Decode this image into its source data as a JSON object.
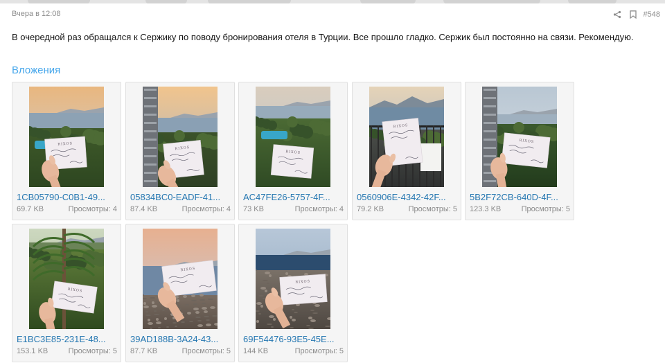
{
  "post": {
    "timestamp": "Вчера в 12:08",
    "number": "#548",
    "message": "В очередной раз обращался к Сержику по поводу бронирования отеля в Турции. Все прошло гладко. Сержик был постоянно на связи. Рекомендую.",
    "share_icon": "share-icon",
    "bookmark_icon": "bookmark-icon"
  },
  "attachments_title": "Вложения",
  "attachments": [
    {
      "name": "1CB05790-C0B1-49...",
      "size": "69.7 KB",
      "views": "Просмотры: 4",
      "scene": "coast-sunset"
    },
    {
      "name": "05834BC0-EADF-41...",
      "size": "87.4 KB",
      "views": "Просмотры: 4",
      "scene": "hotel-pool"
    },
    {
      "name": "AC47FE26-5757-4F...",
      "size": "73 KB",
      "views": "Просмотры: 4",
      "scene": "trees-pool"
    },
    {
      "name": "0560906E-4342-42F...",
      "size": "79.2 KB",
      "views": "Просмотры: 5",
      "scene": "balcony-mountains"
    },
    {
      "name": "5B2F72CB-640D-4F...",
      "size": "123.3 KB",
      "views": "Просмотры: 5",
      "scene": "hotel-garden"
    },
    {
      "name": "E1BC3E85-231E-48...",
      "size": "153.1 KB",
      "views": "Просмотры: 5",
      "scene": "jungle"
    },
    {
      "name": "39AD188B-3A24-43...",
      "size": "87.7 KB",
      "views": "Просмотры: 5",
      "scene": "beach-sunset"
    },
    {
      "name": "69F54476-93E5-45E...",
      "size": "144 KB",
      "views": "Просмотры: 5",
      "scene": "pebble-beach"
    }
  ],
  "card_logo": "RIXOS",
  "colors": {
    "accent": "#47a7eb",
    "link": "#2577b1",
    "muted": "#8c8c8c"
  }
}
